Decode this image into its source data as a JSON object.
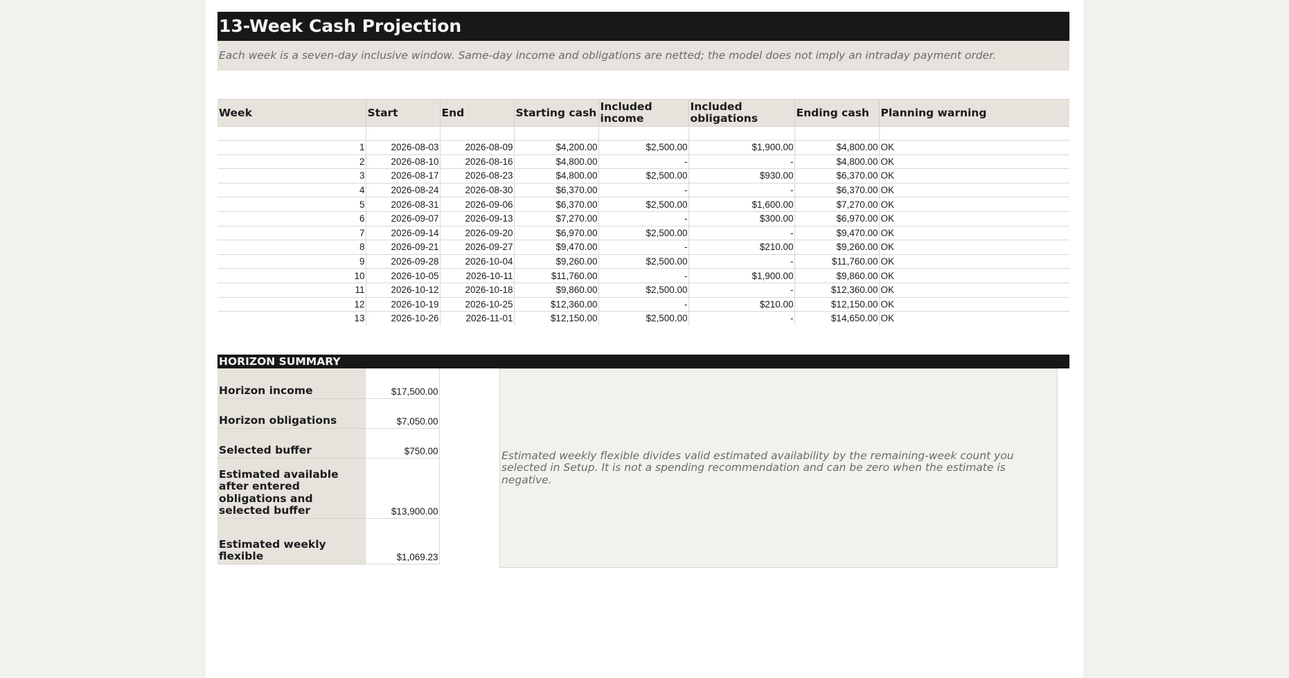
{
  "title": "13-Week Cash Projection",
  "subtitle": "Each week is a seven-day inclusive window. Same-day income and obligations are netted; the model does not imply an intraday payment order.",
  "projection": {
    "headers": [
      "Week",
      "Start",
      "End",
      "Starting cash",
      "Included income",
      "Included obligations",
      "Ending cash",
      "Planning warning"
    ],
    "rows": [
      [
        "1",
        "2026-08-03",
        "2026-08-09",
        "$4,200.00",
        "$2,500.00",
        "$1,900.00",
        "$4,800.00",
        "OK"
      ],
      [
        "2",
        "2026-08-10",
        "2026-08-16",
        "$4,800.00",
        "-",
        "-",
        "$4,800.00",
        "OK"
      ],
      [
        "3",
        "2026-08-17",
        "2026-08-23",
        "$4,800.00",
        "$2,500.00",
        "$930.00",
        "$6,370.00",
        "OK"
      ],
      [
        "4",
        "2026-08-24",
        "2026-08-30",
        "$6,370.00",
        "-",
        "-",
        "$6,370.00",
        "OK"
      ],
      [
        "5",
        "2026-08-31",
        "2026-09-06",
        "$6,370.00",
        "$2,500.00",
        "$1,600.00",
        "$7,270.00",
        "OK"
      ],
      [
        "6",
        "2026-09-07",
        "2026-09-13",
        "$7,270.00",
        "-",
        "$300.00",
        "$6,970.00",
        "OK"
      ],
      [
        "7",
        "2026-09-14",
        "2026-09-20",
        "$6,970.00",
        "$2,500.00",
        "-",
        "$9,470.00",
        "OK"
      ],
      [
        "8",
        "2026-09-21",
        "2026-09-27",
        "$9,470.00",
        "-",
        "$210.00",
        "$9,260.00",
        "OK"
      ],
      [
        "9",
        "2026-09-28",
        "2026-10-04",
        "$9,260.00",
        "$2,500.00",
        "-",
        "$11,760.00",
        "OK"
      ],
      [
        "10",
        "2026-10-05",
        "2026-10-11",
        "$11,760.00",
        "-",
        "$1,900.00",
        "$9,860.00",
        "OK"
      ],
      [
        "11",
        "2026-10-12",
        "2026-10-18",
        "$9,860.00",
        "$2,500.00",
        "-",
        "$12,360.00",
        "OK"
      ],
      [
        "12",
        "2026-10-19",
        "2026-10-25",
        "$12,360.00",
        "-",
        "$210.00",
        "$12,150.00",
        "OK"
      ],
      [
        "13",
        "2026-10-26",
        "2026-11-01",
        "$12,150.00",
        "$2,500.00",
        "-",
        "$14,650.00",
        "OK"
      ]
    ]
  },
  "summary": {
    "heading": "HORIZON SUMMARY",
    "rows": [
      {
        "label": "Horizon income",
        "value": "$17,500.00"
      },
      {
        "label": "Horizon obligations",
        "value": "$7,050.00"
      },
      {
        "label": "Selected buffer",
        "value": "$750.00"
      },
      {
        "label": "Estimated available after entered obligations and selected buffer",
        "value": "$13,900.00"
      },
      {
        "label": "Estimated weekly flexible",
        "value": "$1,069.23"
      }
    ],
    "note": "Estimated weekly flexible divides valid estimated availability by the remaining-week count you selected in Setup. It is not a spending recommendation and can be zero when the estimate is negative."
  }
}
